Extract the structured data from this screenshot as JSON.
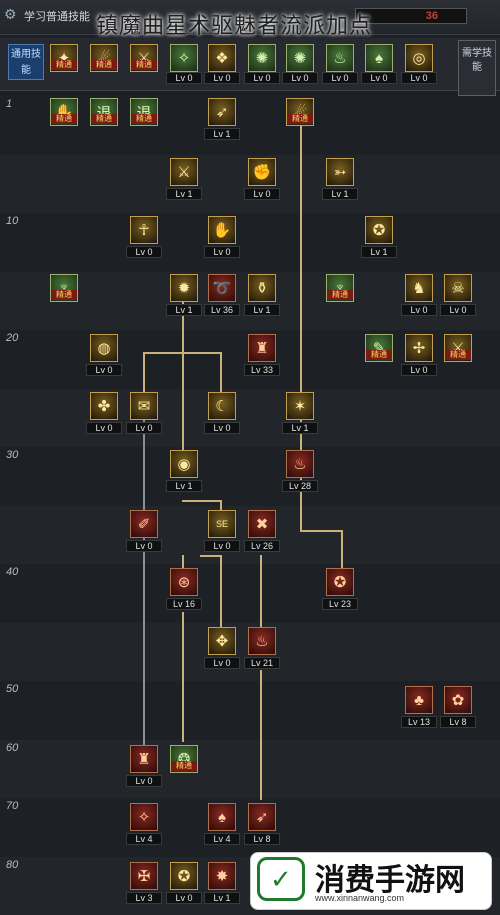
{
  "topbar": {
    "title": "学习普通技能",
    "points_label": "",
    "points_value": "36"
  },
  "overlay_title": "镇魔曲星术驱魅者流派加点",
  "common_label": "通用技能",
  "special_tab": "需学技能",
  "row_labels": [
    "1",
    "10",
    "20",
    "30",
    "40",
    "50",
    "60",
    "70",
    "80"
  ],
  "tag_text": "精通",
  "common_skills": [
    {
      "name": "common-skill-1",
      "icon": "✦",
      "color": "gold",
      "tag": true,
      "lv": ""
    },
    {
      "name": "common-skill-2",
      "icon": "☄",
      "color": "gold",
      "tag": true,
      "lv": ""
    },
    {
      "name": "common-skill-3",
      "icon": "⚔",
      "color": "gold",
      "tag": true,
      "lv": ""
    },
    {
      "name": "common-skill-4",
      "icon": "✧",
      "color": "green",
      "tag": false,
      "lv": "Lv 0"
    },
    {
      "name": "common-skill-5",
      "icon": "❖",
      "color": "gold",
      "tag": false,
      "lv": "Lv 0"
    },
    {
      "name": "common-skill-6",
      "icon": "✺",
      "color": "green",
      "tag": false,
      "lv": "Lv 0"
    },
    {
      "name": "common-skill-7",
      "icon": "✺",
      "color": "green",
      "tag": false,
      "lv": "Lv 0"
    },
    {
      "name": "common-skill-8",
      "icon": "♨",
      "color": "green",
      "tag": false,
      "lv": "Lv 0"
    },
    {
      "name": "common-skill-9",
      "icon": "♠",
      "color": "green",
      "tag": false,
      "lv": "Lv 0"
    },
    {
      "name": "common-skill-10",
      "icon": "◎",
      "color": "gold",
      "tag": false,
      "lv": "Lv 0"
    },
    {
      "name": "common-skill-11",
      "icon": "♟",
      "color": "gold",
      "tag": false,
      "lv": "Lv 0"
    },
    {
      "name": "common-skill-12",
      "icon": "⚚",
      "color": "green",
      "tag": false,
      "lv": "Lv 0"
    }
  ],
  "skills": [
    {
      "name": "skill-r1-a",
      "icon": "✋",
      "color": "green",
      "tag": true,
      "lv": ""
    },
    {
      "name": "skill-r1-b",
      "icon": "退",
      "color": "green",
      "tag": true,
      "lv": ""
    },
    {
      "name": "skill-r1-c",
      "icon": "退",
      "color": "green",
      "tag": true,
      "lv": ""
    },
    {
      "name": "skill-r1-d",
      "icon": "➶",
      "color": "gold",
      "tag": false,
      "lv": "Lv 1"
    },
    {
      "name": "skill-r1-e",
      "icon": "☄",
      "color": "gold",
      "tag": true,
      "lv": ""
    },
    {
      "name": "skill-r2-a",
      "icon": "⚔",
      "color": "gold",
      "tag": false,
      "lv": "Lv 1"
    },
    {
      "name": "skill-r2-b",
      "icon": "✊",
      "color": "gold",
      "tag": false,
      "lv": "Lv 0"
    },
    {
      "name": "skill-r2-c",
      "icon": "➳",
      "color": "gold",
      "tag": false,
      "lv": "Lv 1"
    },
    {
      "name": "skill-r3-a",
      "icon": "☥",
      "color": "gold",
      "tag": false,
      "lv": "Lv 0"
    },
    {
      "name": "skill-r3-b",
      "icon": "✋",
      "color": "gold",
      "tag": false,
      "lv": "Lv 0"
    },
    {
      "name": "skill-r3-c",
      "icon": "✪",
      "color": "gold",
      "tag": false,
      "lv": "Lv 1"
    },
    {
      "name": "skill-r4-a",
      "icon": "♆",
      "color": "green",
      "tag": true,
      "lv": ""
    },
    {
      "name": "skill-r4-b",
      "icon": "✹",
      "color": "gold",
      "tag": false,
      "lv": "Lv 1"
    },
    {
      "name": "skill-r4-c",
      "icon": "➰",
      "color": "red",
      "tag": false,
      "lv": "Lv 36"
    },
    {
      "name": "skill-r4-d",
      "icon": "⚱",
      "color": "gold",
      "tag": false,
      "lv": "Lv 1"
    },
    {
      "name": "skill-r4-e",
      "icon": "♆",
      "color": "green",
      "tag": true,
      "lv": ""
    },
    {
      "name": "skill-r4-f",
      "icon": "♞",
      "color": "gold",
      "tag": false,
      "lv": "Lv 0"
    },
    {
      "name": "skill-r4-g",
      "icon": "☠",
      "color": "gold",
      "tag": false,
      "lv": "Lv 0"
    },
    {
      "name": "skill-r5-a",
      "icon": "◍",
      "color": "gold",
      "tag": false,
      "lv": "Lv 0"
    },
    {
      "name": "skill-r5-b",
      "icon": "♜",
      "color": "red",
      "tag": false,
      "lv": "Lv 33"
    },
    {
      "name": "skill-r5-c",
      "icon": "✎",
      "color": "green",
      "tag": true,
      "lv": ""
    },
    {
      "name": "skill-r5-d",
      "icon": "✢",
      "color": "gold",
      "tag": false,
      "lv": "Lv 0"
    },
    {
      "name": "skill-r5-e",
      "icon": "⚔",
      "color": "gold",
      "tag": true,
      "lv": ""
    },
    {
      "name": "skill-r6-a",
      "icon": "✤",
      "color": "gold",
      "tag": false,
      "lv": "Lv 0"
    },
    {
      "name": "skill-r6-b",
      "icon": "✉",
      "color": "gold",
      "tag": false,
      "lv": "Lv 0"
    },
    {
      "name": "skill-r6-c",
      "icon": "☾",
      "color": "gold",
      "tag": false,
      "lv": "Lv 0"
    },
    {
      "name": "skill-r6-d",
      "icon": "✶",
      "color": "gold",
      "tag": false,
      "lv": "Lv 1"
    },
    {
      "name": "skill-r7-a",
      "icon": "◉",
      "color": "gold",
      "tag": false,
      "lv": "Lv 1"
    },
    {
      "name": "skill-r7-b",
      "icon": "♨",
      "color": "red",
      "tag": false,
      "lv": "Lv 28"
    },
    {
      "name": "skill-r8-a",
      "icon": "✐",
      "color": "red",
      "tag": false,
      "lv": "Lv 0"
    },
    {
      "name": "skill-r8-b",
      "icon": "SE",
      "color": "gold",
      "tag": false,
      "lv": "Lv 0"
    },
    {
      "name": "skill-r8-c",
      "icon": "✖",
      "color": "red",
      "tag": false,
      "lv": "Lv 26"
    },
    {
      "name": "skill-r9-a",
      "icon": "⊛",
      "color": "red",
      "tag": false,
      "lv": "Lv 16"
    },
    {
      "name": "skill-r9-b",
      "icon": "✪",
      "color": "red",
      "tag": false,
      "lv": "Lv 23"
    },
    {
      "name": "skill-r10-a",
      "icon": "✥",
      "color": "gold",
      "tag": false,
      "lv": "Lv 0"
    },
    {
      "name": "skill-r10-b",
      "icon": "♨",
      "color": "red",
      "tag": false,
      "lv": "Lv 21"
    },
    {
      "name": "skill-r11-a",
      "icon": "♣",
      "color": "red",
      "tag": false,
      "lv": "Lv 13"
    },
    {
      "name": "skill-r11-b",
      "icon": "✿",
      "color": "red",
      "tag": false,
      "lv": "Lv 8"
    },
    {
      "name": "skill-r12-a",
      "icon": "♜",
      "color": "red",
      "tag": false,
      "lv": "Lv 0"
    },
    {
      "name": "skill-r12-b",
      "icon": "❂",
      "color": "green",
      "tag": true,
      "lv": ""
    },
    {
      "name": "skill-r13-a",
      "icon": "✧",
      "color": "red",
      "tag": false,
      "lv": "Lv 4"
    },
    {
      "name": "skill-r13-b",
      "icon": "♠",
      "color": "red",
      "tag": false,
      "lv": "Lv 4"
    },
    {
      "name": "skill-r13-c",
      "icon": "➶",
      "color": "red",
      "tag": false,
      "lv": "Lv 8"
    },
    {
      "name": "skill-r14-a",
      "icon": "✠",
      "color": "red",
      "tag": false,
      "lv": "Lv 3"
    },
    {
      "name": "skill-r14-b",
      "icon": "✪",
      "color": "gold",
      "tag": false,
      "lv": "Lv 0"
    },
    {
      "name": "skill-r14-c",
      "icon": "✸",
      "color": "red",
      "tag": false,
      "lv": "Lv 1"
    }
  ],
  "watermark": {
    "brand": "消费手游网",
    "url": "www.xinnanwang.com",
    "logo_char": "✓"
  }
}
